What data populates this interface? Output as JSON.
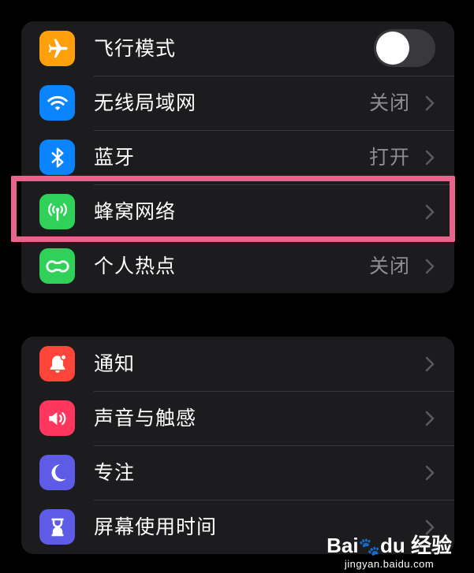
{
  "group1": [
    {
      "label": "飞行模式",
      "icon": "airplane-icon",
      "color": "#ff9f0a",
      "type": "toggle",
      "toggle_on": false
    },
    {
      "label": "无线局域网",
      "icon": "wifi-icon",
      "color": "#0a84ff",
      "value": "关闭"
    },
    {
      "label": "蓝牙",
      "icon": "bluetooth-icon",
      "color": "#0a84ff",
      "value": "打开"
    },
    {
      "label": "蜂窝网络",
      "icon": "cellular-antenna-icon",
      "color": "#30d158",
      "value": ""
    },
    {
      "label": "个人热点",
      "icon": "personal-hotspot-icon",
      "color": "#30d158",
      "value": "关闭"
    }
  ],
  "group2": [
    {
      "label": "通知",
      "icon": "notification-bell-icon",
      "color": "#ff453a"
    },
    {
      "label": "声音与触感",
      "icon": "speaker-icon",
      "color": "#ff375f"
    },
    {
      "label": "专注",
      "icon": "moon-icon",
      "color": "#5e5ce6"
    },
    {
      "label": "屏幕使用时间",
      "icon": "hourglass-icon",
      "color": "#5e5ce6"
    }
  ],
  "highlight_color": "#e8648c",
  "watermark": {
    "brand_a": "Bai",
    "brand_b": "du",
    "brand_c": "经验",
    "url": "jingyan.baidu.com"
  }
}
